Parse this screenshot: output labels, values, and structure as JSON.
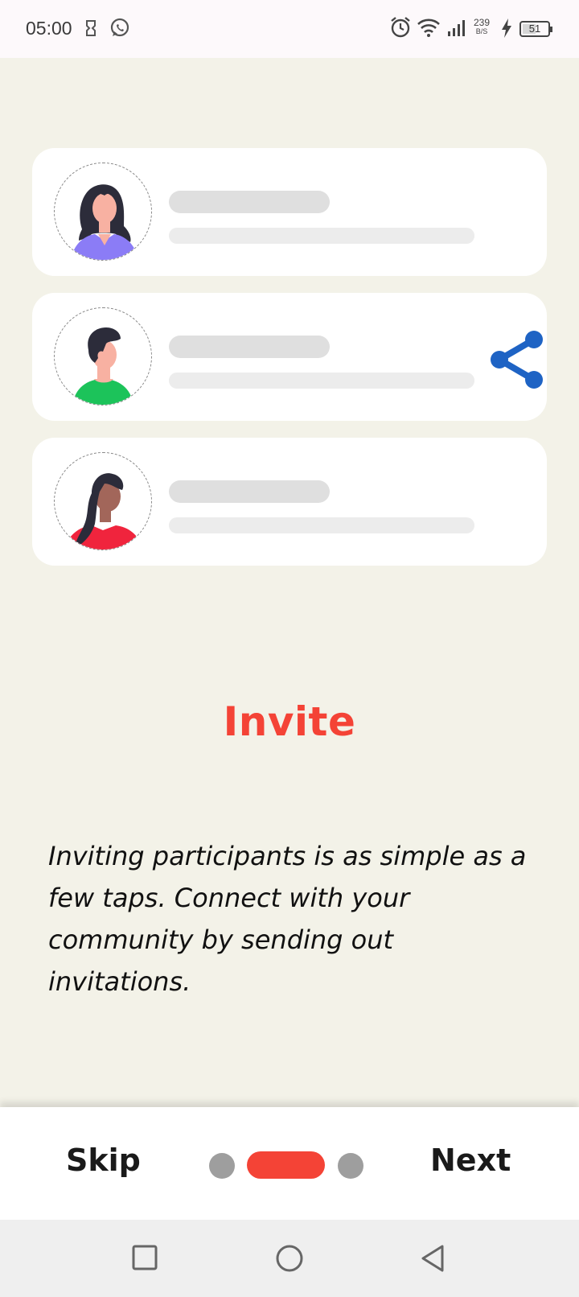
{
  "status_bar": {
    "time": "05:00",
    "net_speed_value": "239",
    "net_speed_unit": "B/S",
    "battery": "51",
    "icons": [
      "sim-manager-icon",
      "whatsapp-icon",
      "alarm-icon",
      "wifi-icon",
      "signal-icon",
      "charging-icon",
      "battery-icon"
    ]
  },
  "cards": [
    {
      "avatar": "woman-avatar-purple",
      "shirt_color": "#8b7cf6"
    },
    {
      "avatar": "man-avatar-green",
      "shirt_color": "#1cc35a",
      "action_icon": "share-icon"
    },
    {
      "avatar": "woman-avatar-red",
      "shirt_color": "#f0243d"
    }
  ],
  "content": {
    "title": "Invite",
    "description": "Inviting participants is as simple as a few taps. Connect with your community by sending out invitations."
  },
  "footer": {
    "skip_label": "Skip",
    "next_label": "Next",
    "page_count": 3,
    "current_page": 2
  },
  "colors": {
    "accent": "#f44336",
    "share": "#1e63c4",
    "background": "#f3f2e8"
  },
  "nav_bar": {
    "buttons": [
      "recents-icon",
      "home-icon",
      "back-icon"
    ]
  }
}
